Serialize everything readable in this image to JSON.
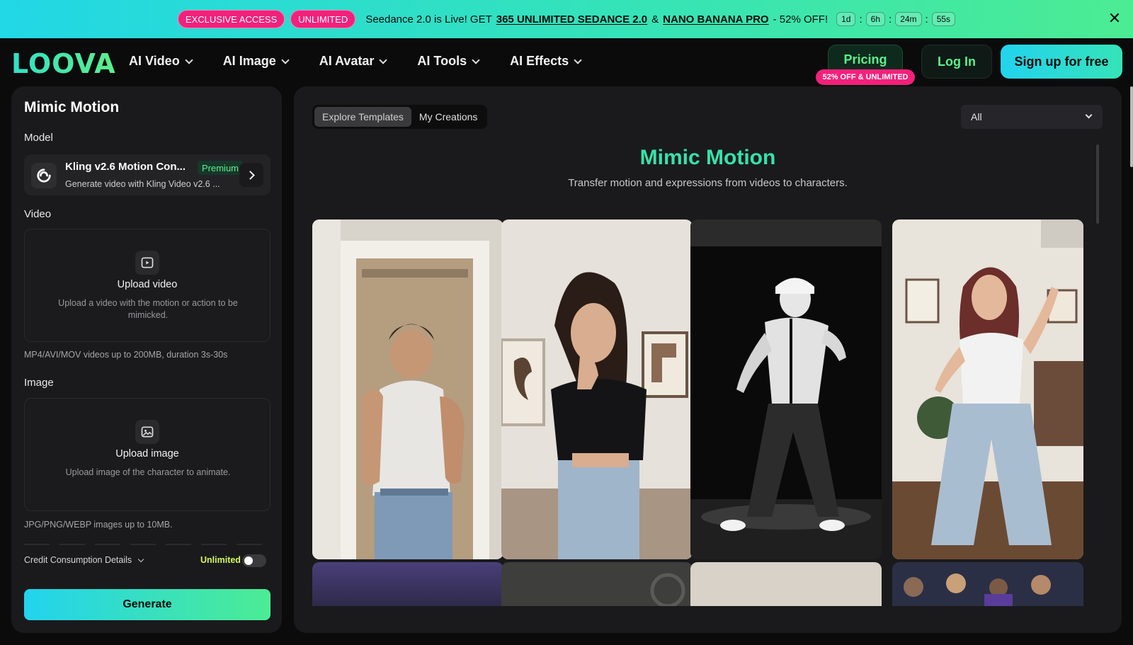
{
  "banner": {
    "pill_exclusive": "EXCLUSIVE ACCESS",
    "pill_unlimited": "UNLIMITED",
    "text_prefix": "Seedance 2.0 is Live! GET",
    "link1": "365 UNLIMITED SEDANCE 2.0",
    "amp": "&",
    "link2": "NANO BANANA PRO",
    "suffix": "- 52% OFF!",
    "timer": [
      "1d",
      "6h",
      "24m",
      "55s"
    ],
    "sep": ":",
    "close": "✕"
  },
  "nav": {
    "logo": "LOOVA",
    "items": [
      "AI Video",
      "AI Image",
      "AI Avatar",
      "AI Tools",
      "AI Effects"
    ],
    "pricing": "Pricing",
    "pricing_badge": "52% OFF & UNLIMITED",
    "login": "Log In",
    "signup": "Sign up for free"
  },
  "left": {
    "title": "Mimic Motion",
    "model_label": "Model",
    "model_name": "Kling v2.6 Motion Con...",
    "model_badge": "Premium",
    "model_desc": "Generate video with Kling Video v2.6 ...",
    "video_label": "Video",
    "video_upload_title": "Upload video",
    "video_upload_desc": "Upload a video with the motion or action to be mimicked.",
    "video_hint": "MP4/AVI/MOV videos up to 200MB, duration 3s-30s",
    "image_label": "Image",
    "image_upload_title": "Upload image",
    "image_upload_desc": "Upload image of the character to animate.",
    "image_hint": "JPG/PNG/WEBP images up to 10MB.",
    "credit": "Credit Consumption Details",
    "unlimited": "Unlimited",
    "generate": "Generate"
  },
  "right": {
    "tabs": [
      "Explore Templates",
      "My Creations"
    ],
    "filter_value": "All",
    "title": "Mimic Motion",
    "subtitle": "Transfer motion and expressions from videos to characters."
  },
  "colors": {
    "accent_green": "#35e3a8",
    "accent_cyan": "#22d3ee",
    "pink": "#f2217b",
    "panel": "#1a1a1c"
  }
}
